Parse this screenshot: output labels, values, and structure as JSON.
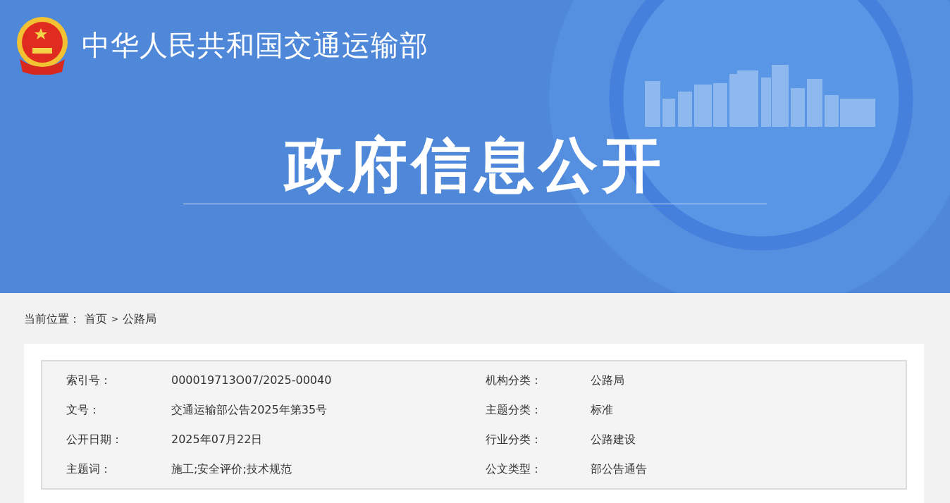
{
  "header": {
    "site_title": "中华人民共和国交通运输部",
    "banner_title": "政府信息公开"
  },
  "breadcrumb": {
    "label": "当前位置：",
    "separator": ">",
    "items": [
      {
        "text": "首页"
      },
      {
        "text": "公路局"
      }
    ]
  },
  "info": [
    {
      "label": "索引号：",
      "value": "000019713O07/2025-00040"
    },
    {
      "label": "机构分类：",
      "value": "公路局"
    },
    {
      "label": "文号：",
      "value": "交通运输部公告2025年第35号"
    },
    {
      "label": "主题分类：",
      "value": "标准"
    },
    {
      "label": "公开日期：",
      "value": "2025年07月22日"
    },
    {
      "label": "行业分类：",
      "value": "公路建设"
    },
    {
      "label": "主题词：",
      "value": "施工;安全评价;技术规范"
    },
    {
      "label": "公文类型：",
      "value": "部公告通告"
    }
  ]
}
